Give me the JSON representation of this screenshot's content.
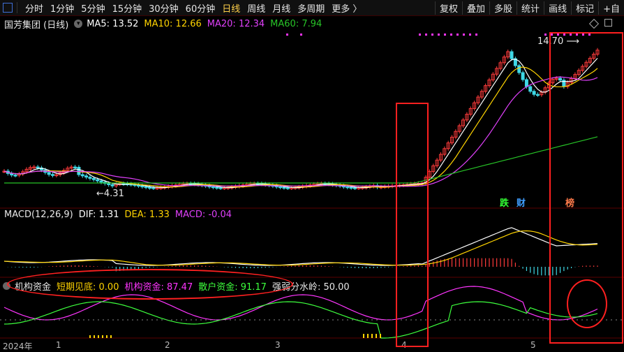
{
  "toolbar": {
    "items": [
      {
        "label": "分时",
        "active": false
      },
      {
        "label": "1分钟",
        "active": false
      },
      {
        "label": "5分钟",
        "active": false
      },
      {
        "label": "15分钟",
        "active": false
      },
      {
        "label": "30分钟",
        "active": false
      },
      {
        "label": "60分钟",
        "active": false
      },
      {
        "label": "日线",
        "active": true
      },
      {
        "label": "周线",
        "active": false
      },
      {
        "label": "月线",
        "active": false
      },
      {
        "label": "多周期",
        "active": false
      },
      {
        "label": "更多 〉",
        "active": false
      }
    ],
    "right_items": [
      "复权",
      "叠加",
      "多股",
      "统计",
      "画线",
      "标记",
      "+自"
    ]
  },
  "header": {
    "stock": "国芳集团 (日线)",
    "ma5": "MA5: 13.52",
    "ma10": "MA10: 12.66",
    "ma20": "MA20: 12.34",
    "ma60": "MA60: 7.94"
  },
  "price_panel": {
    "high_label": "14.70",
    "low_label": "4.31",
    "badges": [
      "跌",
      "财",
      "榜"
    ]
  },
  "macd_panel": {
    "title": "MACD(12,26,9)",
    "dif": "DIF: 1.31",
    "dea": "DEA: 1.33",
    "macd": "MACD: -0.04"
  },
  "fund_panel": {
    "title": "机构资金",
    "short": "短期见底: 0.00",
    "inst": "机构资金: 87.47",
    "retail": "散户资金: 91.17",
    "water": "强弱分水岭: 50.00"
  },
  "axis": {
    "labels": [
      "2024年",
      "1",
      "2",
      "3",
      "4",
      "5"
    ]
  },
  "colors": {
    "up": "#ff3b3b",
    "down": "#3fd8e6",
    "ma5": "#ffffff",
    "ma10": "#ffd400",
    "ma20": "#e040fb",
    "ma60": "#27c427",
    "inst": "#ff35ff",
    "retail": "#3dff3d",
    "annotation": "#ff2020"
  }
}
